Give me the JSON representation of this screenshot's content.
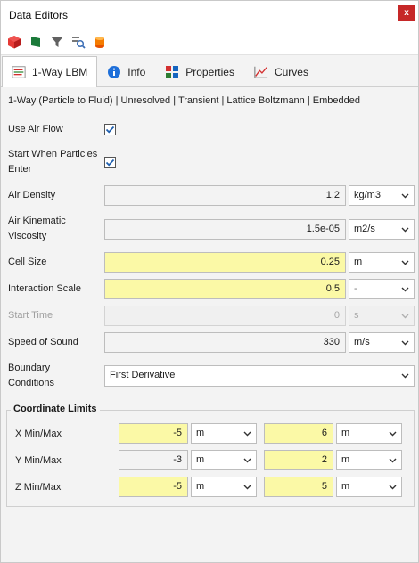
{
  "window": {
    "title": "Data Editors",
    "close_label": "x"
  },
  "toolbar": {
    "icons": [
      {
        "name": "red-cube-icon",
        "color": "#d32f2f"
      },
      {
        "name": "green-flag-icon",
        "color": "#1b7a3a"
      },
      {
        "name": "filter-icon",
        "color": "#555555"
      },
      {
        "name": "search-icon",
        "color": "#555555"
      },
      {
        "name": "orange-cylinder-icon",
        "color": "#f57c00"
      }
    ]
  },
  "tabs": [
    {
      "label": "1-Way LBM",
      "active": true
    },
    {
      "label": "Info",
      "active": false
    },
    {
      "label": "Properties",
      "active": false
    },
    {
      "label": "Curves",
      "active": false
    }
  ],
  "subtitle": "1-Way (Particle to Fluid) | Unresolved | Transient | Lattice Boltzmann | Embedded",
  "fields": {
    "use_air_flow": {
      "label": "Use Air Flow",
      "checked": true
    },
    "start_when_particles_enter": {
      "label_line1": "Start When Particles",
      "label_line2": "Enter",
      "checked": true
    },
    "air_density": {
      "label": "Air Density",
      "value": "1.2",
      "unit": "kg/m3"
    },
    "air_kinematic_viscosity": {
      "label_line1": "Air Kinematic",
      "label_line2": "Viscosity",
      "value": "1.5e-05",
      "unit": "m2/s"
    },
    "cell_size": {
      "label": "Cell Size",
      "value": "0.25",
      "unit": "m"
    },
    "interaction_scale": {
      "label": "Interaction Scale",
      "value": "0.5",
      "unit": "-"
    },
    "start_time": {
      "label": "Start Time",
      "value": "0",
      "unit": "s"
    },
    "speed_of_sound": {
      "label": "Speed of Sound",
      "value": "330",
      "unit": "m/s"
    },
    "boundary_conditions": {
      "label_line1": "Boundary",
      "label_line2": "Conditions",
      "value": "First Derivative"
    }
  },
  "coordinate_limits": {
    "title": "Coordinate Limits",
    "rows": [
      {
        "label": "X Min/Max",
        "min": "-5",
        "min_unit": "m",
        "max": "6",
        "max_unit": "m"
      },
      {
        "label": "Y Min/Max",
        "min": "-3",
        "min_unit": "m",
        "max": "2",
        "max_unit": "m"
      },
      {
        "label": "Z Min/Max",
        "min": "-5",
        "min_unit": "m",
        "max": "5",
        "max_unit": "m"
      }
    ]
  },
  "colors": {
    "highlight": "#fbf9a6",
    "checkbox": "#1f5fae",
    "close": "#c62828"
  }
}
